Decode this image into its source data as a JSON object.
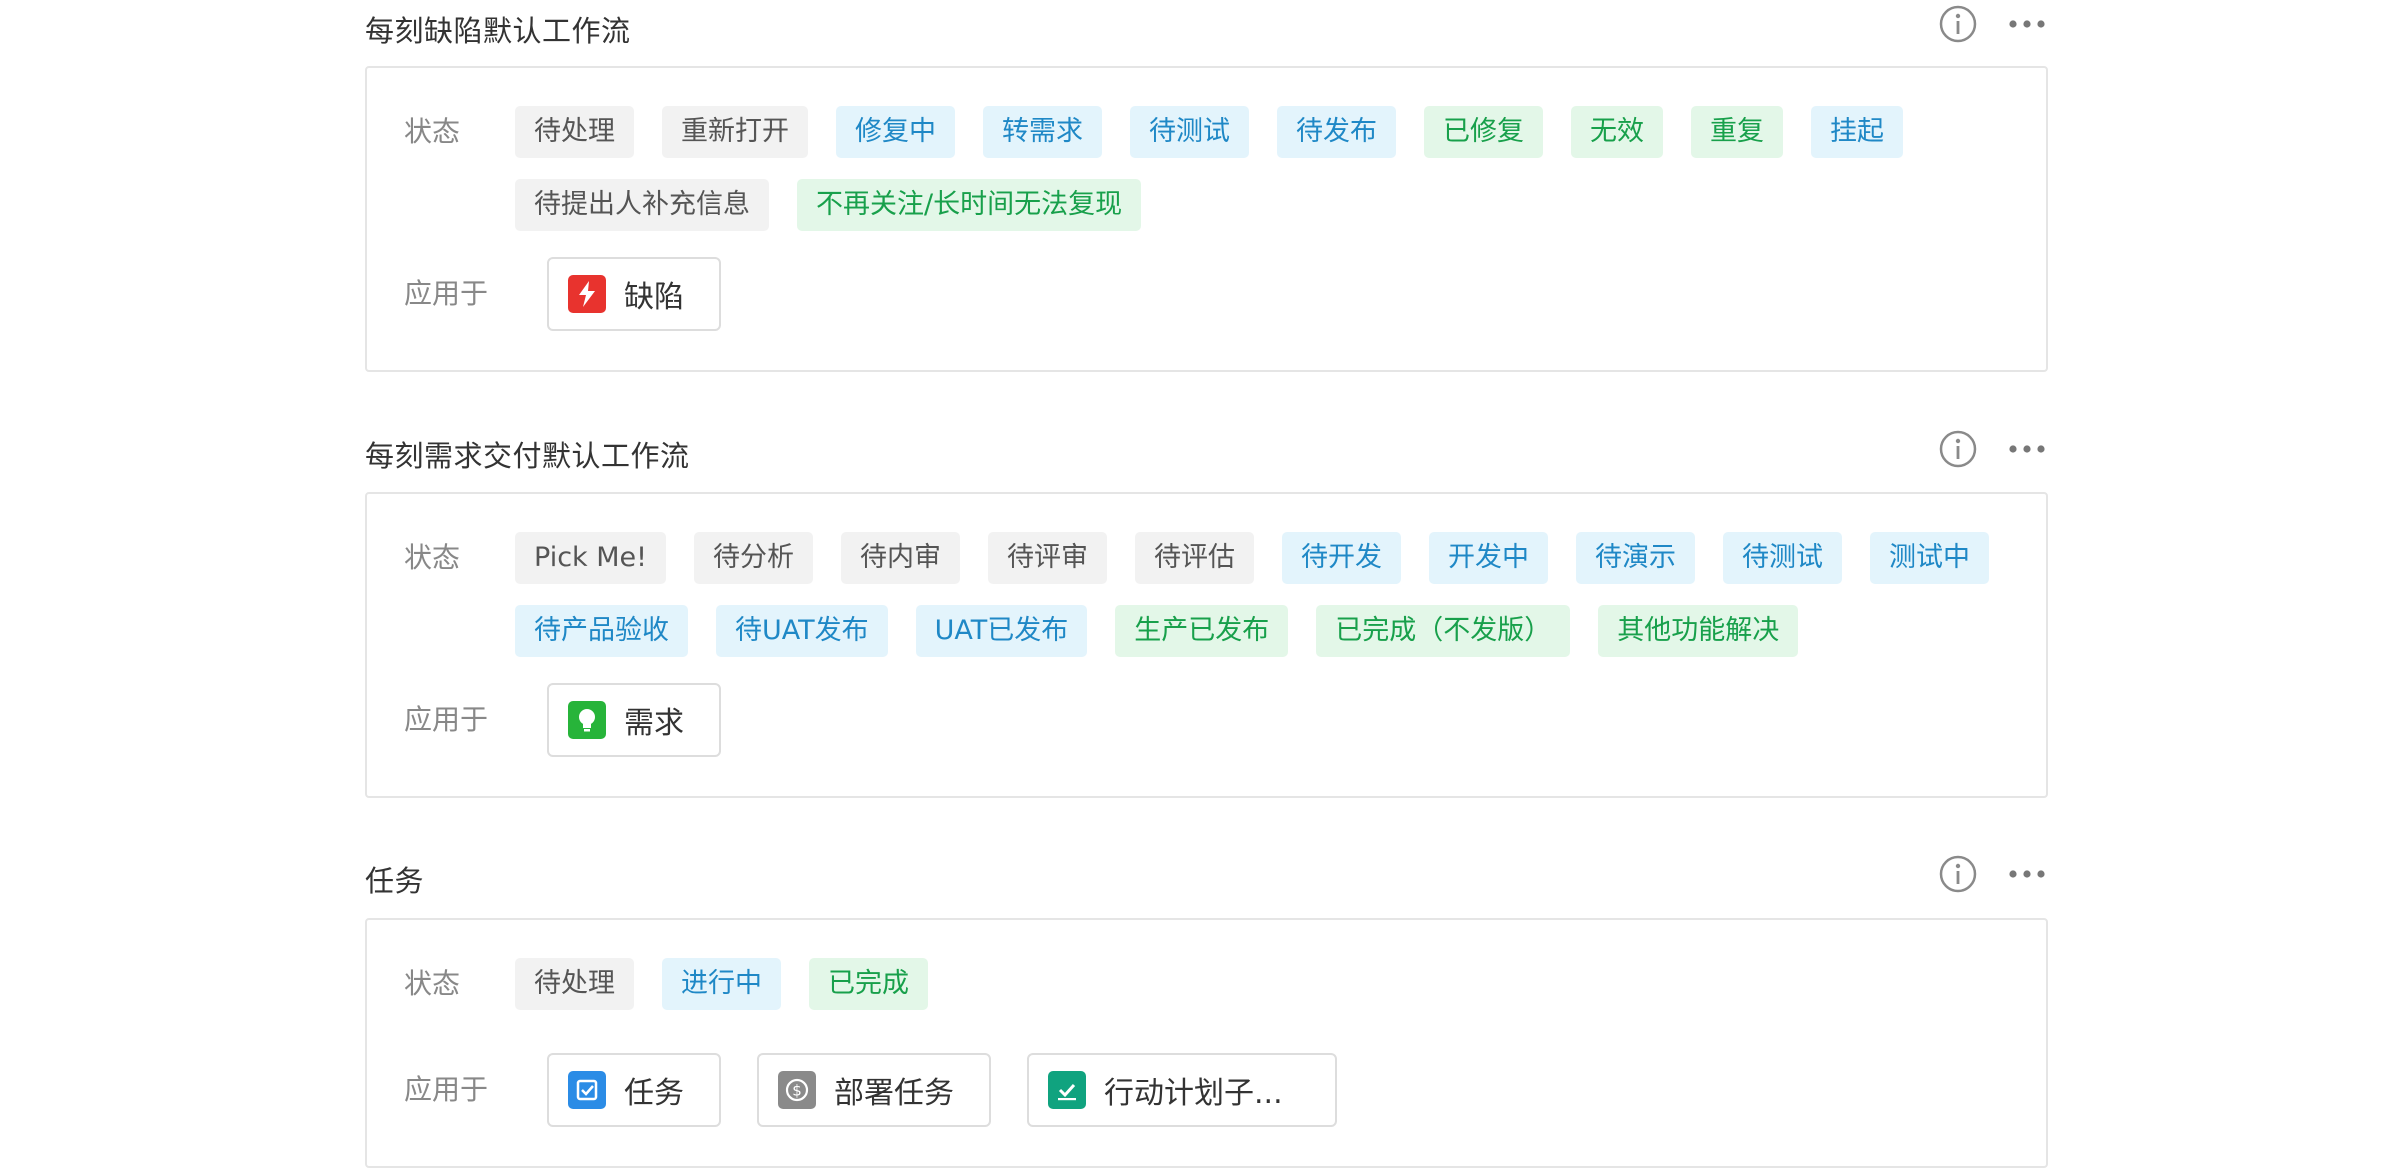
{
  "colors": {
    "tag_gray_bg": "#f2f2f2",
    "tag_gray_text": "#555555",
    "tag_blue_bg": "#e3f4fc",
    "tag_blue_text": "#1f88c6",
    "tag_green_bg": "#e3f7e8",
    "tag_green_text": "#18a04b",
    "bug_icon": "#e8332e",
    "req_icon": "#27b43a",
    "task_icon": "#2b8ce6",
    "deploy_icon": "#8a8a8a",
    "action_icon": "#10a37f"
  },
  "labels": {
    "status": "状态",
    "applies_to": "应用于"
  },
  "sections": [
    {
      "title": "每刻缺陷默认工作流",
      "icons": [
        "info-icon",
        "more-icon"
      ],
      "statuses": [
        {
          "label": "待处理",
          "color": "gray"
        },
        {
          "label": "重新打开",
          "color": "gray"
        },
        {
          "label": "修复中",
          "color": "blue"
        },
        {
          "label": "转需求",
          "color": "blue"
        },
        {
          "label": "待测试",
          "color": "blue"
        },
        {
          "label": "待发布",
          "color": "blue"
        },
        {
          "label": "已修复",
          "color": "green"
        },
        {
          "label": "无效",
          "color": "green"
        },
        {
          "label": "重复",
          "color": "green"
        },
        {
          "label": "挂起",
          "color": "blue"
        },
        {
          "label": "待提出人补充信息",
          "color": "gray"
        },
        {
          "label": "不再关注/长时间无法复现",
          "color": "green"
        }
      ],
      "applies_to": [
        {
          "label": "缺陷",
          "icon": "bolt-icon",
          "color": "#e8332e"
        }
      ]
    },
    {
      "title": "每刻需求交付默认工作流",
      "icons": [
        "info-icon",
        "more-icon"
      ],
      "statuses": [
        {
          "label": "Pick Me!",
          "color": "gray"
        },
        {
          "label": "待分析",
          "color": "gray"
        },
        {
          "label": "待内审",
          "color": "gray"
        },
        {
          "label": "待评审",
          "color": "gray"
        },
        {
          "label": "待评估",
          "color": "gray"
        },
        {
          "label": "待开发",
          "color": "blue"
        },
        {
          "label": "开发中",
          "color": "blue"
        },
        {
          "label": "待演示",
          "color": "blue"
        },
        {
          "label": "待测试",
          "color": "blue"
        },
        {
          "label": "测试中",
          "color": "blue"
        },
        {
          "label": "待产品验收",
          "color": "blue"
        },
        {
          "label": "待UAT发布",
          "color": "blue"
        },
        {
          "label": "UAT已发布",
          "color": "blue"
        },
        {
          "label": "生产已发布",
          "color": "green"
        },
        {
          "label": "已完成（不发版）",
          "color": "green"
        },
        {
          "label": "其他功能解决",
          "color": "green"
        }
      ],
      "applies_to": [
        {
          "label": "需求",
          "icon": "lightbulb-icon",
          "color": "#27b43a"
        }
      ]
    },
    {
      "title": "任务",
      "icons": [
        "info-icon",
        "more-icon"
      ],
      "statuses": [
        {
          "label": "待处理",
          "color": "gray"
        },
        {
          "label": "进行中",
          "color": "blue"
        },
        {
          "label": "已完成",
          "color": "green"
        }
      ],
      "applies_to": [
        {
          "label": "任务",
          "icon": "task-icon",
          "color": "#2b8ce6"
        },
        {
          "label": "部署任务",
          "icon": "dollar-icon",
          "color": "#8a8a8a"
        },
        {
          "label": "行动计划子...",
          "icon": "checkbox-icon",
          "color": "#10a37f"
        }
      ]
    }
  ]
}
